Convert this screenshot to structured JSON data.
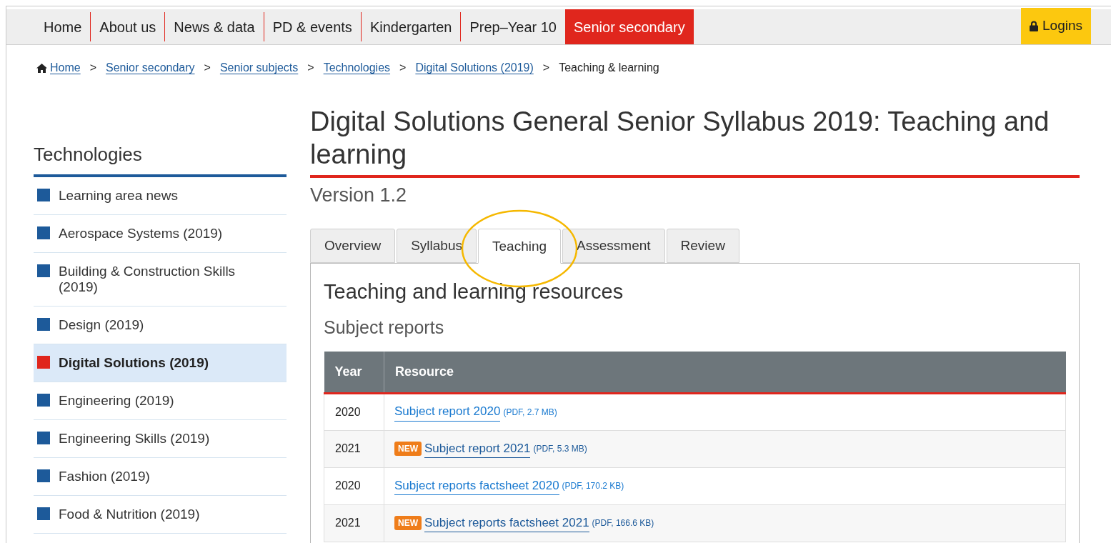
{
  "nav": {
    "items": [
      {
        "label": "Home",
        "selected": false
      },
      {
        "label": "About us",
        "selected": false
      },
      {
        "label": "News & data",
        "selected": false
      },
      {
        "label": "PD & events",
        "selected": false
      },
      {
        "label": "Kindergarten",
        "selected": false
      },
      {
        "label": "Prep–Year 10",
        "selected": false
      },
      {
        "label": "Senior secondary",
        "selected": true
      }
    ],
    "logins": "Logins"
  },
  "breadcrumb": {
    "links": [
      "Home",
      "Senior secondary",
      "Senior subjects",
      "Technologies",
      "Digital Solutions (2019)"
    ],
    "separator": ">",
    "current": "Teaching & learning"
  },
  "sidebar": {
    "title": "Technologies",
    "items": [
      {
        "label": "Learning area news",
        "selected": false
      },
      {
        "label": "Aerospace Systems (2019)",
        "selected": false
      },
      {
        "label": "Building & Construction Skills (2019)",
        "selected": false
      },
      {
        "label": "Design (2019)",
        "selected": false
      },
      {
        "label": "Digital Solutions (2019)",
        "selected": true
      },
      {
        "label": "Engineering (2019)",
        "selected": false
      },
      {
        "label": "Engineering Skills (2019)",
        "selected": false
      },
      {
        "label": "Fashion (2019)",
        "selected": false
      },
      {
        "label": "Food & Nutrition (2019)",
        "selected": false
      }
    ]
  },
  "page": {
    "title": "Digital Solutions General Senior Syllabus 2019: Teaching and learning",
    "version": "Version 1.2"
  },
  "tabs": [
    {
      "label": "Overview",
      "selected": false,
      "circled": false
    },
    {
      "label": "Syllabus",
      "selected": false,
      "circled": false
    },
    {
      "label": "Teaching",
      "selected": true,
      "circled": true
    },
    {
      "label": "Assessment",
      "selected": false,
      "circled": false
    },
    {
      "label": "Review",
      "selected": false,
      "circled": false
    }
  ],
  "panel": {
    "heading": "Teaching and learning resources",
    "subheading": "Subject reports",
    "table": {
      "columns": [
        "Year",
        "Resource"
      ],
      "rows": [
        {
          "year": "2020",
          "new": false,
          "badge": "",
          "link": "Subject report 2020",
          "meta": "(PDF, 2.7 MB)"
        },
        {
          "year": "2021",
          "new": true,
          "badge": "NEW",
          "link": "Subject report 2021",
          "meta": "(PDF, 5.3 MB)"
        },
        {
          "year": "2020",
          "new": false,
          "badge": "",
          "link": "Subject reports factsheet 2020",
          "meta": "(PDF, 170.2 KB)"
        },
        {
          "year": "2021",
          "new": true,
          "badge": "NEW",
          "link": "Subject reports factsheet 2021",
          "meta": "(PDF, 166.6 KB)"
        }
      ]
    }
  }
}
